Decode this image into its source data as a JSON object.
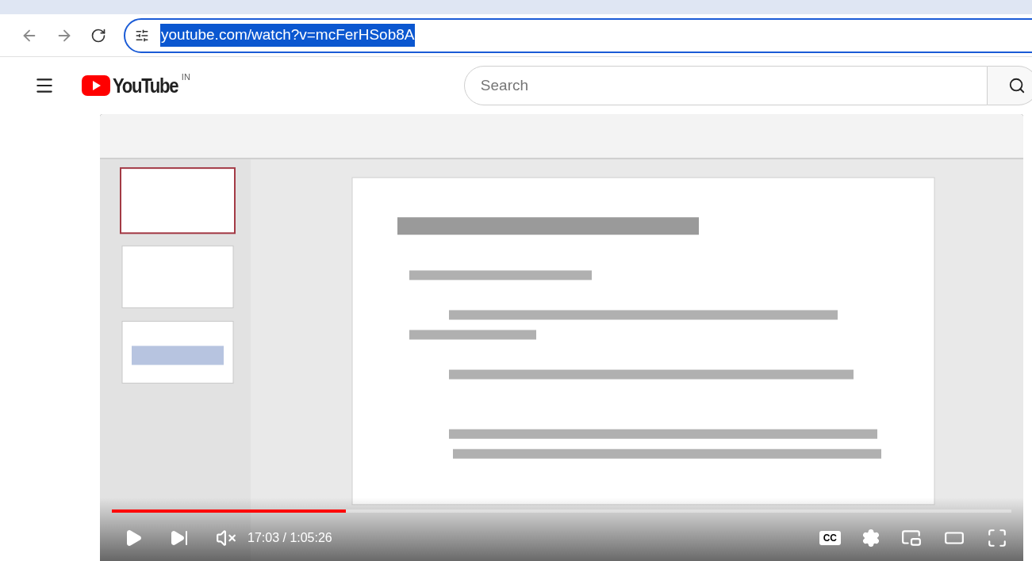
{
  "browser": {
    "url": "youtube.com/watch?v=mcFerHSob8A",
    "url_selected": true
  },
  "header": {
    "logo_text": "YouTube",
    "region": "IN",
    "search": {
      "placeholder": "Search"
    }
  },
  "player": {
    "progress": {
      "level": 0.26
    },
    "time": "17:03 / 1:05:26",
    "muted": true,
    "captions_label": "CC"
  }
}
